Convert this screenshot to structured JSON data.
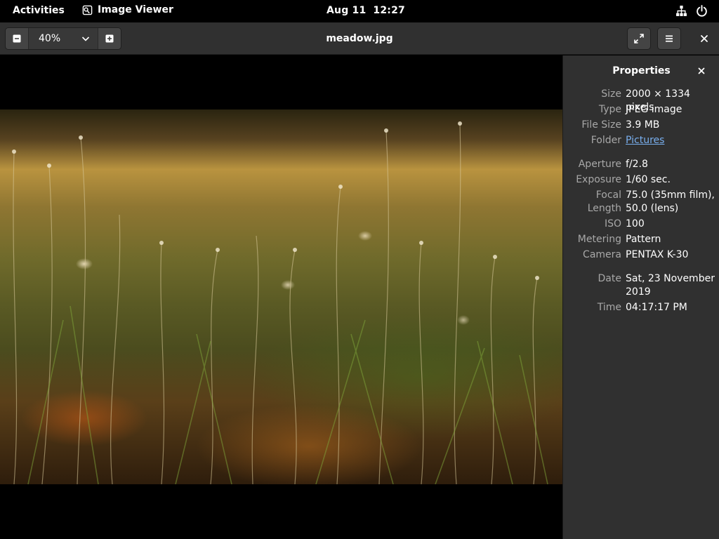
{
  "topbar": {
    "activities": "Activities",
    "app_name": "Image Viewer",
    "app_icon": "image-viewer-icon",
    "date": "Aug 11",
    "time": "12:27",
    "tray_icons": [
      "network-wired-icon",
      "power-icon"
    ]
  },
  "header": {
    "title": "meadow.jpg",
    "zoom_value": "40%",
    "zoom_out_icon": "zoom-out-icon",
    "zoom_in_icon": "zoom-in-icon",
    "fullscreen_icon": "fullscreen-icon",
    "menu_icon": "hamburger-menu-icon",
    "close_icon": "close-icon"
  },
  "panel": {
    "title": "Properties",
    "groups": [
      [
        {
          "key": "Size",
          "value": "2000 × 1334 pixels"
        },
        {
          "key": "Type",
          "value": "JPEG image"
        },
        {
          "key": "File Size",
          "value": "3.9 MB"
        },
        {
          "key": "Folder",
          "value": "Pictures",
          "link": true
        }
      ],
      [
        {
          "key": "Aperture",
          "value": "f/2.8"
        },
        {
          "key": "Exposure",
          "value": "1/60 sec."
        },
        {
          "key": "Focal Length",
          "value": "75.0 (35mm film), 50.0 (lens)"
        },
        {
          "key": "ISO",
          "value": "100"
        },
        {
          "key": "Metering",
          "value": "Pattern"
        },
        {
          "key": "Camera",
          "value": "PENTAX K-30"
        }
      ],
      [
        {
          "key": "Date",
          "value": "Sat, 23 November 2019"
        },
        {
          "key": "Time",
          "value": "04:17:17 PM"
        }
      ]
    ]
  },
  "colors": {
    "panel_bg": "#303030",
    "header_bg": "#303030",
    "link": "#78aeed",
    "label": "#a8a8a8"
  }
}
